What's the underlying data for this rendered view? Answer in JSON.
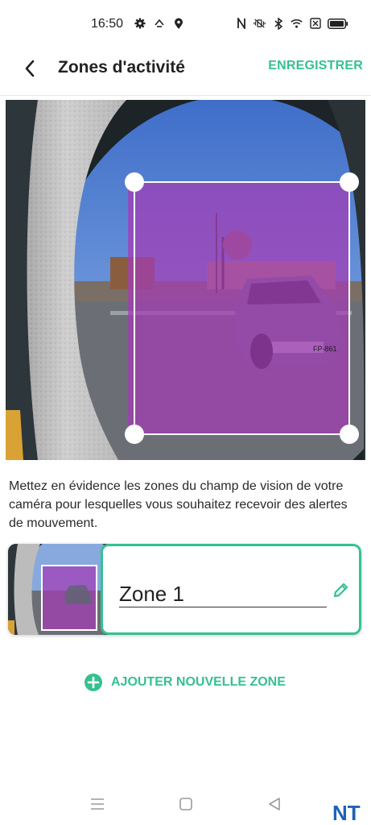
{
  "status_bar": {
    "time": "16:50",
    "left_icons": [
      "gear-icon",
      "rotate-icon",
      "location-icon"
    ],
    "right_icons": [
      "nfc-icon",
      "vibrate-icon",
      "bluetooth-icon",
      "wifi-icon",
      "battery-saver-icon",
      "battery-icon"
    ]
  },
  "header": {
    "title": "Zones d'activité",
    "save_label": "ENREGISTRER",
    "back_icon": "chevron-left-icon"
  },
  "camera": {
    "plate_text": "FP-861"
  },
  "description": "Mettez en évidence les zones du champ de vision de votre caméra pour lesquelles vous souhaitez recevoir des alertes de mouvement.",
  "zones": [
    {
      "name": "Zone 1",
      "edit_icon": "pencil-icon"
    }
  ],
  "add_zone": {
    "label": "AJOUTER NOUVELLE ZONE",
    "icon": "plus-circle-icon"
  },
  "nav_bar": {
    "buttons": [
      "menu-icon",
      "home-icon",
      "back-icon"
    ]
  },
  "watermark": "NT",
  "colors": {
    "accent": "#35c18f",
    "zone_overlay": "#a43bb6"
  }
}
